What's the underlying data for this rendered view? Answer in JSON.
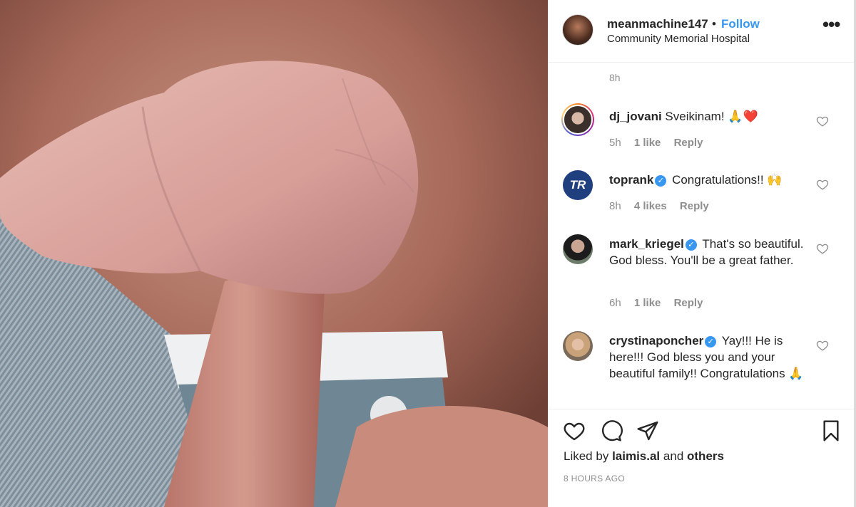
{
  "post": {
    "username": "meanmachine147",
    "separator": "•",
    "follow_label": "Follow",
    "location": "Community Memorial Hospital",
    "more_label": "•••",
    "caption_time": "8h",
    "photo_description": "newborn-baby-hand-holding-finger"
  },
  "comments": [
    {
      "username": "dj_jovani",
      "verified": false,
      "text": "Sveikinam! 🙏❤️",
      "time": "5h",
      "likes": "1 like",
      "reply": "Reply",
      "avatar_color": "#3a2f2a"
    },
    {
      "username": "toprank",
      "verified": true,
      "text": "Congratulations!! 🙌",
      "time": "8h",
      "likes": "4 likes",
      "reply": "Reply",
      "avatar_color": "#1f3f7f",
      "avatar_text": "TR"
    },
    {
      "username": "mark_kriegel",
      "verified": true,
      "text": "That's so beautiful. God bless. You'll be a great father.",
      "time": "6h",
      "likes": "1 like",
      "reply": "Reply",
      "avatar_color": "#2b2b2b"
    },
    {
      "username": "crystinaponcher",
      "verified": true,
      "text": "Yay!!! He is here!!! God bless you and your beautiful family!! Congratulations 🙏",
      "avatar_color": "#c9a27a"
    }
  ],
  "footer": {
    "liked_by_prefix": "Liked by",
    "liked_by_user": "laimis.al",
    "liked_by_and": "and",
    "liked_by_others": "others",
    "timestamp": "8 HOURS AGO"
  },
  "colors": {
    "link_blue": "#3897f0",
    "text": "#262626",
    "muted": "#8e8e8e",
    "border": "#efefef"
  },
  "icons": [
    "more-options-icon",
    "heart-icon",
    "comment-icon",
    "share-icon",
    "bookmark-icon",
    "verified-badge-icon"
  ]
}
